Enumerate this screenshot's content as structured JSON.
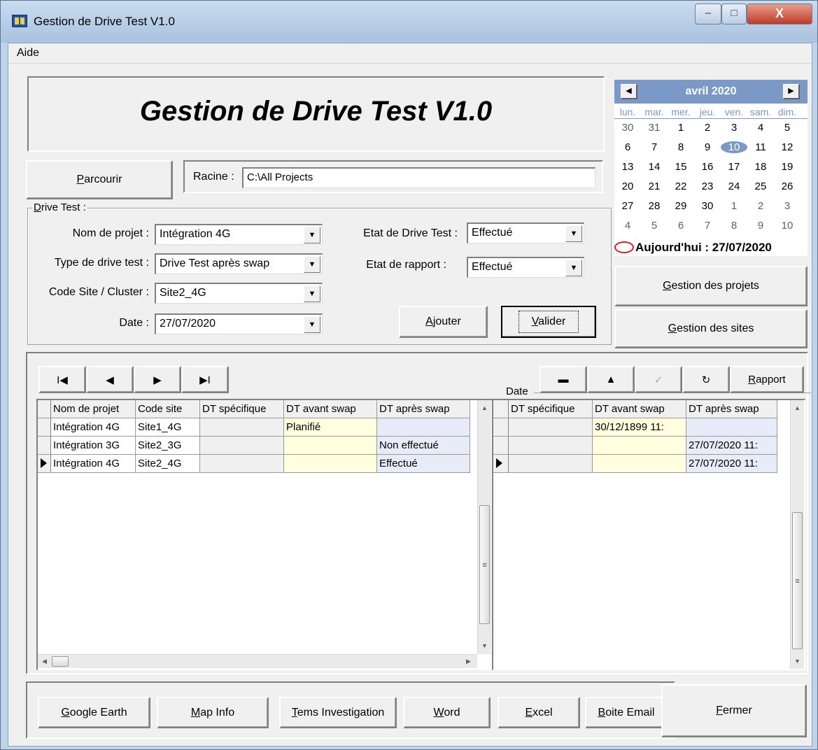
{
  "window": {
    "title": "Gestion de Drive Test  V1.0",
    "caption_buttons": {
      "minimize": "–",
      "maximize": "□",
      "close": "X"
    }
  },
  "menu": {
    "aide": "Aide"
  },
  "header": {
    "title": "Gestion de Drive Test  V1.0"
  },
  "path": {
    "browse_prefix": "",
    "browse_underlined": "P",
    "browse_suffix": "arcourir",
    "racine_label": "Racine :",
    "racine_value": "C:\\All Projects"
  },
  "drive_test": {
    "legend_underlined": "D",
    "legend_suffix": "rive Test :",
    "nom_projet_label": "Nom de projet :",
    "nom_projet_value": "Intégration 4G",
    "type_label": "Type de drive test :",
    "type_value": "Drive Test après swap",
    "code_site_label": "Code Site / Cluster :",
    "code_site_value": "Site2_4G",
    "date_label": "Date :",
    "date_value": "27/07/2020",
    "etat_dt_label": "Etat de Drive Test :",
    "etat_dt_value": "Effectué",
    "etat_rapport_label": "Etat de rapport :",
    "etat_rapport_value": "Effectué",
    "ajouter_underlined": "A",
    "ajouter_suffix": "jouter",
    "valider_underlined": "V",
    "valider_suffix": "alider",
    "dropdown_arrow": "▼"
  },
  "calendar": {
    "month": "avril 2020",
    "prev": "◀",
    "next": "▶",
    "dow": [
      "lun.",
      "mar.",
      "mer.",
      "jeu.",
      "ven.",
      "sam.",
      "dim."
    ],
    "weeks": [
      [
        "30",
        "31",
        "1",
        "2",
        "3",
        "4",
        "5"
      ],
      [
        "6",
        "7",
        "8",
        "9",
        "10",
        "11",
        "12"
      ],
      [
        "13",
        "14",
        "15",
        "16",
        "17",
        "18",
        "19"
      ],
      [
        "20",
        "21",
        "22",
        "23",
        "24",
        "25",
        "26"
      ],
      [
        "27",
        "28",
        "29",
        "30",
        "1",
        "2",
        "3"
      ],
      [
        "4",
        "5",
        "6",
        "7",
        "8",
        "9",
        "10"
      ]
    ],
    "selected_day": "10",
    "today_label": "Aujourd'hui : 27/07/2020"
  },
  "side_buttons": {
    "projets_underlined": "G",
    "projets_suffix": "estion des projets",
    "sites_underlined": "G",
    "sites_suffix": "estion des sites"
  },
  "navigator": {
    "first": "I◀",
    "prior": "◀",
    "next": "▶",
    "last": "▶I",
    "delete": "▬",
    "edit": "▲",
    "post": "✓",
    "refresh": "↻",
    "rapport_underlined": "R",
    "rapport_suffix": "apport",
    "date_label": "Date"
  },
  "left_grid": {
    "columns": [
      "Nom de projet",
      "Code site",
      "DT spécifique",
      "DT avant swap",
      "DT après swap"
    ],
    "rows": [
      [
        "Intégration 4G",
        "Site1_4G",
        "",
        "Planifié",
        ""
      ],
      [
        "Intégration 3G",
        "Site2_3G",
        "",
        "",
        "Non effectué"
      ],
      [
        "Intégration 4G",
        "Site2_4G",
        "",
        "",
        "Effectué"
      ]
    ]
  },
  "right_grid": {
    "columns": [
      "DT spécifique",
      "DT avant swap",
      "DT après swap"
    ],
    "rows": [
      [
        "",
        "30/12/1899 11:",
        ""
      ],
      [
        "",
        "",
        "27/07/2020 11:"
      ],
      [
        "",
        "",
        "27/07/2020 11:"
      ]
    ]
  },
  "bottom_buttons": {
    "google_earth": [
      "G",
      "oogle Earth"
    ],
    "map_info": [
      "M",
      "ap Info"
    ],
    "tems": [
      "T",
      "ems Investigation"
    ],
    "word": [
      "W",
      "ord"
    ],
    "excel": [
      "E",
      "xcel"
    ],
    "email": [
      "B",
      "oite Email"
    ],
    "fermer": [
      "F",
      "ermer"
    ]
  },
  "colors": {
    "calendar_accent": "#7a99c6",
    "today_ring": "#e02020",
    "grid_yellow": "#ffffe0",
    "grid_blue": "#e8ecf8"
  }
}
